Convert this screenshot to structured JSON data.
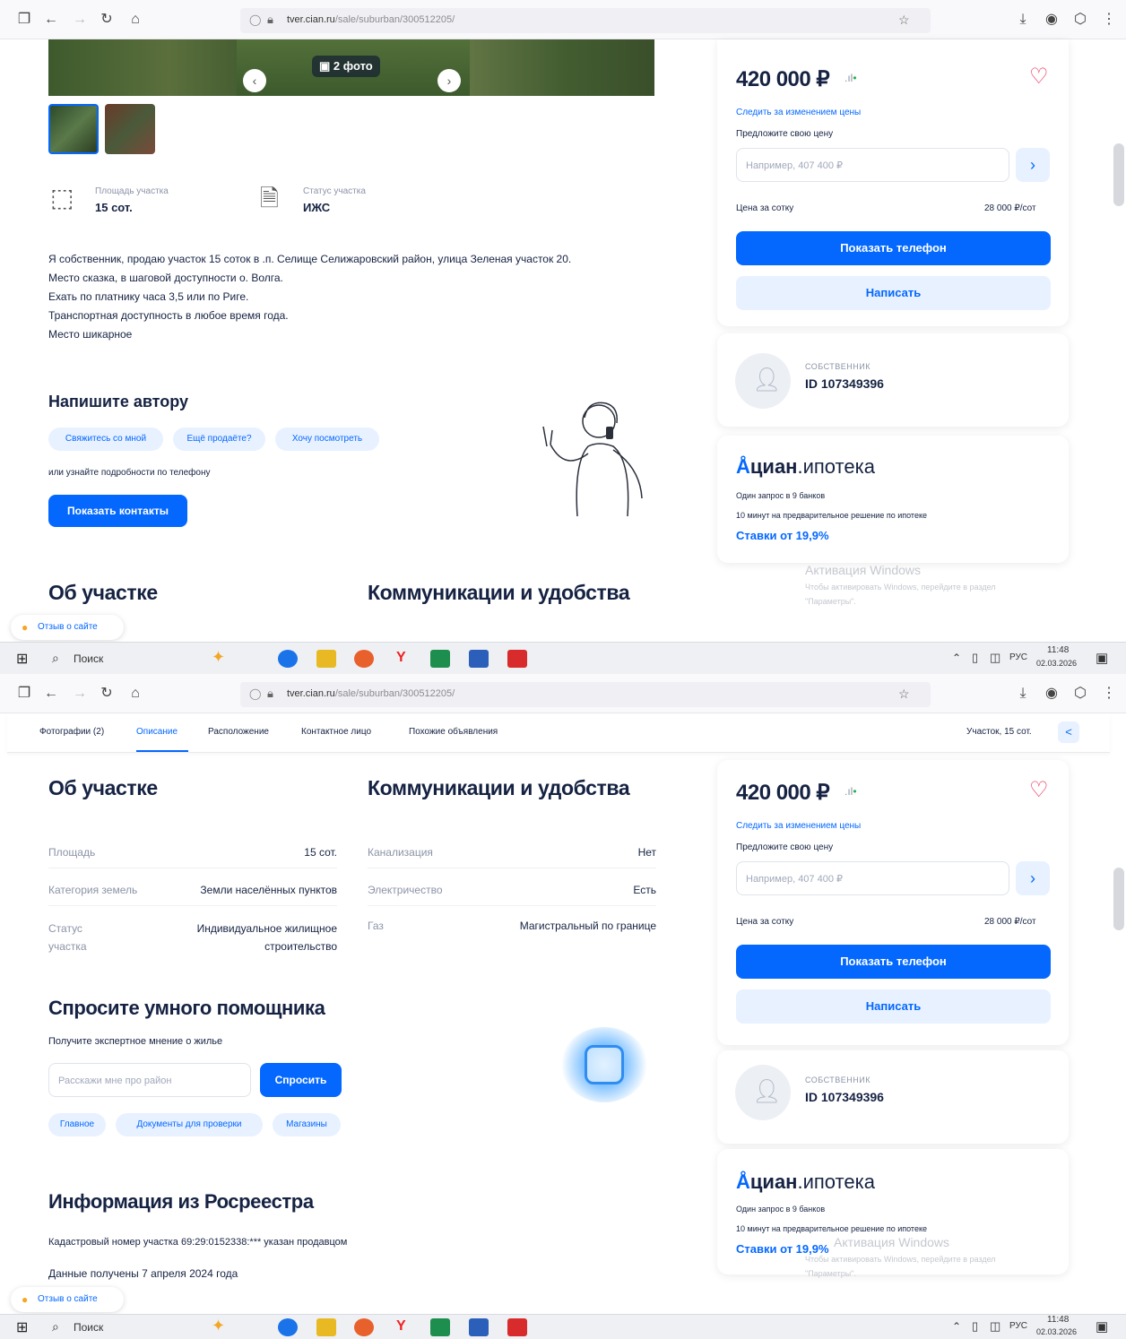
{
  "browser": {
    "url_host": "tver.cian.ru",
    "url_path": "/sale/suburban/300512205/"
  },
  "taskbar": {
    "search_placeholder": "Поиск",
    "lang": "РУС",
    "time": "11:48",
    "date": "02.03.2026"
  },
  "gallery": {
    "photo_count": "2 фото"
  },
  "params": [
    {
      "label": "Площадь участка",
      "value": "15 сот."
    },
    {
      "label": "Статус участка",
      "value": "ИЖС"
    }
  ],
  "description": [
    "Я собственник, продаю участок 15 соток в .п. Селище Селижаровский район, улица Зеленая участок 20.",
    "Место сказка, в шаговой доступности о. Волга.",
    "Ехать по платнику часа 3,5 или по Риге.",
    "Транспортная доступность в любое время года.",
    "Место шикарное"
  ],
  "write_author": {
    "title": "Напишите автору",
    "chips": [
      "Свяжитесь со мной",
      "Ещё продаёте?",
      "Хочу посмотреть"
    ],
    "phone_hint": "или узнайте подробности по телефону",
    "contacts_button": "Показать контакты"
  },
  "sections": {
    "about": "Об участке",
    "communications": "Коммуникации и удобства"
  },
  "sidebar": {
    "price": "420 000 ₽",
    "follow_price": "Следить за изменением цены",
    "offer_price": "Предложите свою цену",
    "offer_placeholder": "Например, 407 400 ₽",
    "price_per_label": "Цена за сотку",
    "price_per_value": "28 000 ₽/сот",
    "show_phone": "Показать телефон",
    "write": "Написать",
    "owner_role": "СОБСТВЕННИК",
    "owner_id": "ID 107349396"
  },
  "mortgage": {
    "brand_bold": "циан",
    "brand_light": ".ипотека",
    "line1": "Один запрос в 9 банков",
    "line2": "10 минут на предварительное решение по ипотеке",
    "rate": "Ставки от 19,9%"
  },
  "watermark": {
    "title": "Активация Windows",
    "line1": "Чтобы активировать Windows, перейдите в раздел",
    "line2": "\"Параметры\"."
  },
  "feedback": "Отзыв о сайте",
  "tabs": [
    "Фотографии (2)",
    "Описание",
    "Расположение",
    "Контактное лицо",
    "Похожие объявления"
  ],
  "tab_right": "Участок, 15 сот.",
  "about_rows": [
    {
      "label": "Площадь",
      "value": "15 сот."
    },
    {
      "label": "Категория земель",
      "value": "Земли населённых пунктов"
    },
    {
      "label": "Статус участка",
      "value": "Индивидуальное жилищное строительство"
    }
  ],
  "comm_rows": [
    {
      "label": "Канализация",
      "value": "Нет"
    },
    {
      "label": "Электричество",
      "value": "Есть"
    },
    {
      "label": "Газ",
      "value": "Магистральный по границе"
    }
  ],
  "assistant": {
    "title": "Спросите умного помощника",
    "subtitle": "Получите экспертное мнение о жилье",
    "placeholder": "Расскажи мне про район",
    "ask_button": "Спросить",
    "chips": [
      "Главное",
      "Документы для проверки",
      "Магазины"
    ]
  },
  "rosreestr": {
    "title": "Информация из Росреестра",
    "cadastral": "Кадастровый номер участка 69:29:0152338:*** указан продавцом",
    "date": "Данные получены 7 апреля 2024 года"
  },
  "colors": {
    "accent": "#0468ff",
    "light_accent": "#e8f1ff",
    "heart": "#e8305a",
    "text": "#152242"
  }
}
